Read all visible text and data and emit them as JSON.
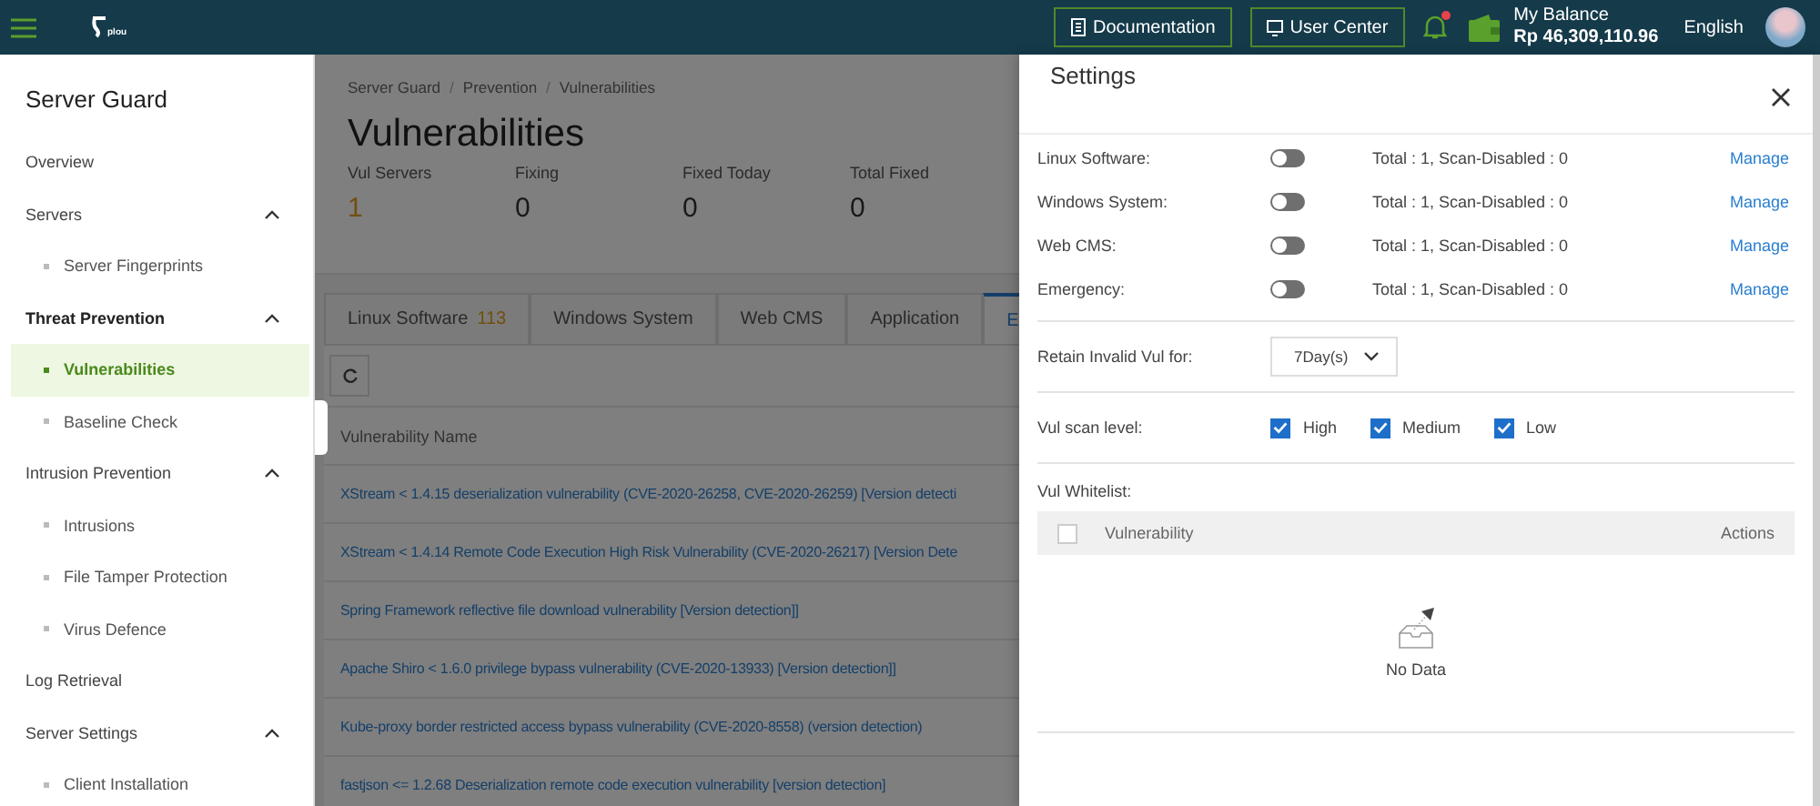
{
  "topbar": {
    "brand": "plou",
    "buttons": [
      {
        "label": "Documentation",
        "kind": "doc"
      },
      {
        "label": "User Center",
        "kind": "monitor"
      }
    ],
    "notification": {
      "unread": true
    },
    "balance": {
      "label": "My Balance",
      "amount": "Rp 46,309,110.96"
    },
    "language": "English"
  },
  "sidebar": {
    "title": "Server Guard",
    "items": [
      {
        "label": "Overview",
        "selected": false
      },
      {
        "label": "Servers",
        "expanded": true,
        "children": [
          {
            "label": "Server Fingerprints",
            "selected": false
          }
        ]
      },
      {
        "label": "Threat Prevention",
        "expanded": true,
        "children": [
          {
            "label": "Vulnerabilities",
            "selected": true
          },
          {
            "label": "Baseline Check",
            "selected": false
          }
        ]
      },
      {
        "label": "Intrusion Prevention",
        "expanded": true,
        "children": [
          {
            "label": "Intrusions",
            "selected": false
          },
          {
            "label": "File Tamper Protection",
            "selected": false
          },
          {
            "label": "Virus Defence",
            "selected": false
          }
        ]
      },
      {
        "label": "Log Retrieval",
        "selected": false
      },
      {
        "label": "Server Settings",
        "expanded": true,
        "children": [
          {
            "label": "Client Installation",
            "selected": false
          }
        ]
      }
    ]
  },
  "main": {
    "breadcrumb": {
      "separator": "/",
      "items": [
        "Server Guard",
        "Prevention",
        "Vulnerabilities"
      ]
    },
    "title": "Vulnerabilities",
    "stats": [
      {
        "label": "Vul Servers",
        "value": "1",
        "highlight": true
      },
      {
        "label": "Fixing",
        "value": "0",
        "highlight": false
      },
      {
        "label": "Fixed Today",
        "value": "0",
        "highlight": false
      },
      {
        "label": "Total Fixed",
        "value": "0",
        "highlight": false
      }
    ],
    "tabs": [
      {
        "label": "Linux Software",
        "count": "113",
        "selected": false
      },
      {
        "label": "Windows System",
        "selected": false
      },
      {
        "label": "Web CMS",
        "selected": false
      },
      {
        "label": "Application",
        "selected": false
      },
      {
        "label": "E",
        "selected": true
      }
    ],
    "table": {
      "columns": [
        "Vulnerability Name"
      ],
      "rows": [
        "XStream < 1.4.15 deserialization vulnerability (CVE-2020-26258, CVE-2020-26259) [Version detecti",
        "XStream < 1.4.14 Remote Code Execution High Risk Vulnerability (CVE-2020-26217) [Version Dete",
        "Spring Framework reflective file download vulnerability [Version detection]]",
        "Apache Shiro < 1.6.0 privilege bypass vulnerability (CVE-2020-13933) [Version detection]]",
        "Kube-proxy border restricted access bypass vulnerability (CVE-2020-8558) (version detection)",
        "fastjson <= 1.2.68 Deserialization remote code execution vulnerability [version detection]"
      ]
    }
  },
  "settings": {
    "title": "Settings",
    "categories": [
      {
        "label": "Linux Software:",
        "on": false,
        "summary": "Total : 1, Scan-Disabled : 0",
        "action": "Manage"
      },
      {
        "label": "Windows System:",
        "on": false,
        "summary": "Total : 1, Scan-Disabled : 0",
        "action": "Manage"
      },
      {
        "label": "Web CMS:",
        "on": false,
        "summary": "Total : 1, Scan-Disabled : 0",
        "action": "Manage"
      },
      {
        "label": "Emergency:",
        "on": false,
        "summary": "Total : 1, Scan-Disabled : 0",
        "action": "Manage"
      }
    ],
    "retain": {
      "label": "Retain Invalid Vul for:",
      "value": "7Day(s)"
    },
    "scan_level": {
      "label": "Vul scan level:",
      "options": [
        {
          "label": "High",
          "checked": true
        },
        {
          "label": "Medium",
          "checked": true
        },
        {
          "label": "Low",
          "checked": true
        }
      ]
    },
    "whitelist": {
      "label": "Vul Whitelist:",
      "select_all_checked": false,
      "columns": [
        "Vulnerability",
        "Actions"
      ],
      "empty_text": "No Data"
    }
  }
}
